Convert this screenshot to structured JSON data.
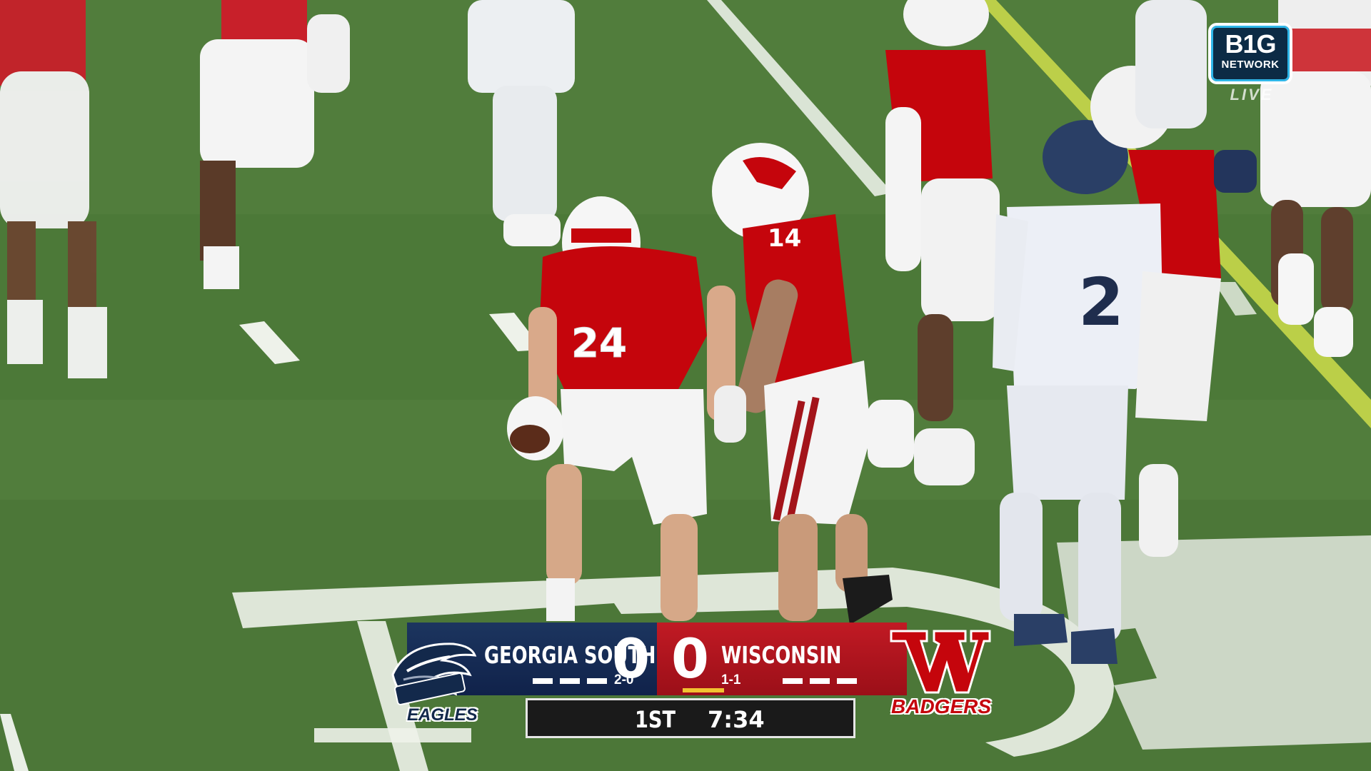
{
  "broadcast": {
    "network_line1": "B1G",
    "network_line2": "NETWORK",
    "live_label": "LIVE"
  },
  "scoreboard": {
    "away": {
      "name": "GEORGIA SOUTHERN",
      "score": "0",
      "record": "2-0",
      "timeouts_remaining": 3,
      "logo_text": "GEORGIA SOUTHERN",
      "wordmark": "EAGLES",
      "color": "#13294b"
    },
    "home": {
      "name": "WISCONSIN",
      "score": "0",
      "record": "1-1",
      "timeouts_remaining": 3,
      "wordmark": "BADGERS",
      "color": "#c5050c",
      "has_possession": true
    },
    "quarter": "1ST",
    "clock": "7:34"
  },
  "players": {
    "ball_carrier_number": "24",
    "teammate_number": "14",
    "opponent_number": "2"
  }
}
